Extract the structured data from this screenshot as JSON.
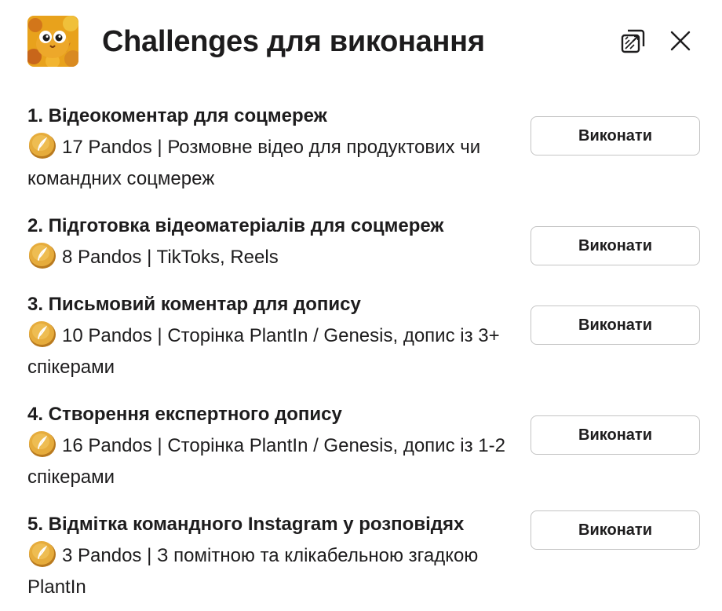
{
  "header": {
    "title": "Challenges для виконання",
    "popout_icon": "popout-window-icon",
    "close_icon": "close-icon"
  },
  "coin_icon": "gold-coin-icon",
  "items": [
    {
      "title": "1. Відеокоментар для соцмереж",
      "desc": "17 Pandos | Розмовне відео для продуктових чи командних соцмереж",
      "button": "Виконати"
    },
    {
      "title": "2. Підготовка відеоматеріалів для соцмереж",
      "desc": "8 Pandos | TikToks, Reels",
      "button": "Виконати"
    },
    {
      "title": "3. Письмовий коментар для допису",
      "desc": "10 Pandos | Сторінка PlantIn / Genesis, допис із 3+ спікерами",
      "button": "Виконати"
    },
    {
      "title": "4. Створення експертного допису",
      "desc": "16 Pandos | Сторінка PlantIn / Genesis, допис із 1-2 спікерами",
      "button": "Виконати"
    },
    {
      "title": "5. Відмітка командного Instagram у розповідях",
      "desc": "3 Pandos | З помітною та клікабельною згадкою PlantIn",
      "button": "Виконати"
    }
  ],
  "colors": {
    "text": "#1d1c1d",
    "button_border": "#c4c4c4",
    "coin": "#e0a83a"
  }
}
